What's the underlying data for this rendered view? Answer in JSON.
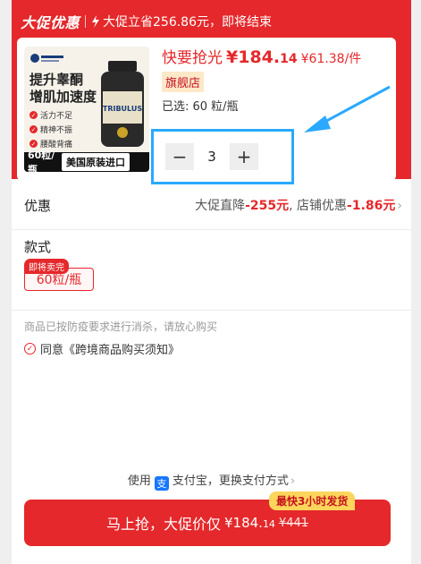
{
  "promo": {
    "brand": "大促优惠",
    "lightning_icon": "lightning-icon",
    "savings_text": "大促立省256.86元，即将结束"
  },
  "product": {
    "image": {
      "title_line1": "提升睾酮",
      "title_line2": "增肌加速度",
      "tags": [
        "活力不足",
        "精神不振",
        "腰酸背痛"
      ],
      "bottle_label": "TRIBULUS",
      "count_text": "60粒/瓶",
      "made_in": "美国原装进口"
    },
    "price_prefix": "快要抢光",
    "price_main": "¥184.",
    "price_decimal": "14",
    "unit_price": "¥61.38/件",
    "store_badge": "旗舰店",
    "selected_text": "已选: 60 粒/瓶"
  },
  "quantity": {
    "minus": "−",
    "value": "3",
    "plus": "+"
  },
  "discount": {
    "label": "优惠",
    "prefix": "大促直降",
    "promo_amount": "-255元",
    "separator": ", 店铺优惠",
    "store_amount": "-1.86元",
    "chevron": "›"
  },
  "style": {
    "label": "款式",
    "soon_tag": "即将卖完",
    "option": "60粒/瓶"
  },
  "notice": "商品已按防疫要求进行消杀，请放心购买",
  "agreement": {
    "icon": "check-circle-icon",
    "text": "同意《跨境商品购买须知》"
  },
  "payment": {
    "prefix": "使用",
    "alipay_glyph": "支",
    "method": "支付宝，更换支付方式",
    "chevron": "›"
  },
  "shipping_badge": "最快3小时发货",
  "buy_button": {
    "label": "马上抢，大促价仅",
    "price": "¥184.",
    "price_decimal": "14",
    "original_price": "¥441"
  },
  "colors": {
    "accent": "#e5282b",
    "highlight_annotation": "#2aa9ff",
    "badge_yellow": "#fcd65b"
  }
}
